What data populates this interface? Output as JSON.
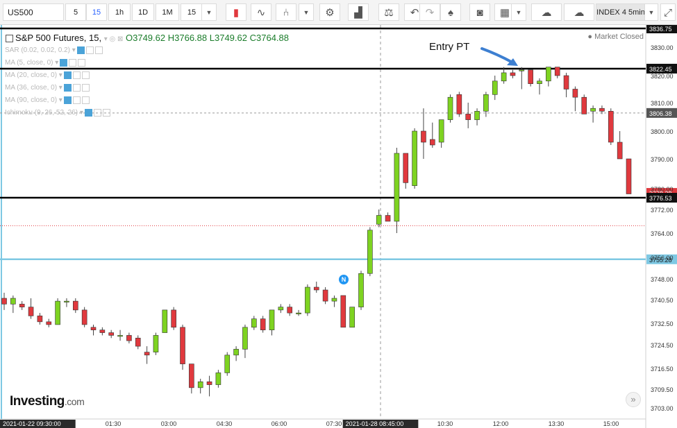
{
  "toolbar": {
    "symbol": "US500",
    "intervals": [
      "5",
      "15",
      "1h",
      "1D",
      "1M",
      "15"
    ],
    "active_interval": "15",
    "right_label": "INDEX 4 5min",
    "icons": [
      "dropdown-icon",
      "candles-icon",
      "indicators-icon",
      "fork-icon",
      "dropdown-icon",
      "settings-icon",
      "compare-icon",
      "balance-icon",
      "undo-icon",
      "redo-icon",
      "alert-icon",
      "camera-icon",
      "layout-icon",
      "dropdown-icon",
      "cloud-download-icon",
      "cloud-upload-icon",
      "dropdown-icon",
      "fullscreen-icon"
    ]
  },
  "legend": {
    "title": "S&P 500 Futures, 15,",
    "open": "O3749.62",
    "high": "H3766.88",
    "low": "L3749.62",
    "close": "C3764.88",
    "market_status": "Market Closed",
    "indicators": [
      "SAR (0.02, 0.02, 0.2)",
      "MA (5, close, 0)",
      "MA (20, close, 0)",
      "MA (36, close, 0)",
      "MA (90, close, 0)",
      "Ichimoku (9, 26, 52, 26)"
    ]
  },
  "annotation": {
    "entry_label": "Entry PT",
    "news_badge": "N"
  },
  "brand": {
    "logo": "Investing",
    "logo_suffix": ".com",
    "scroll_glyph": "»"
  },
  "colors": {
    "up": "#7ed321",
    "down": "#e0393e",
    "blue_line": "#7ec8e3",
    "red_dotted": "#e0393e"
  },
  "chart_data": {
    "type": "candlestick",
    "y_ticks": [
      3830,
      3820,
      3810,
      3800,
      3790,
      3780,
      3772,
      3764,
      3756,
      3748,
      3740.5,
      3732.5,
      3724.5,
      3716.5,
      3709.5,
      3703
    ],
    "x_ticks": [
      "2021-01-22 09:30:00",
      "01:30",
      "03:00",
      "04:30",
      "06:00",
      "07:30",
      "2021-01-28 08:45:00",
      "10:30",
      "12:00",
      "13:30",
      "15:00"
    ],
    "levels": [
      {
        "price": 3836.75,
        "label": "3836.75",
        "style": "black-thick"
      },
      {
        "price": 3822.45,
        "label": "3822.45",
        "style": "black-thick"
      },
      {
        "price": 3806.38,
        "label": "3806.38",
        "style": "grey-dashed"
      },
      {
        "price": 3778.38,
        "label": "3778.38",
        "style": "red-price"
      },
      {
        "price": 3776.53,
        "label": "3776.53",
        "style": "black-thick"
      },
      {
        "price": 3766.5,
        "label": "",
        "style": "red-dotted"
      },
      {
        "price": 3755.28,
        "label": "3755.28",
        "style": "blue-thick"
      }
    ],
    "candles": [
      [
        3741,
        3743,
        3737,
        3739
      ],
      [
        3739,
        3742,
        3736,
        3741
      ],
      [
        3739,
        3740,
        3737,
        3738
      ],
      [
        3738,
        3741,
        3734,
        3735
      ],
      [
        3735,
        3736,
        3732,
        3733
      ],
      [
        3733,
        3734,
        3731,
        3732
      ],
      [
        3732,
        3741,
        3732,
        3740
      ],
      [
        3740,
        3741,
        3738,
        3740
      ],
      [
        3740,
        3741,
        3736,
        3737
      ],
      [
        3737,
        3738,
        3731,
        3732
      ],
      [
        3731,
        3732,
        3728,
        3730
      ],
      [
        3730,
        3731,
        3728,
        3729
      ],
      [
        3729,
        3730,
        3727,
        3728
      ],
      [
        3728,
        3730,
        3726,
        3728
      ],
      [
        3728,
        3729,
        3725,
        3726
      ],
      [
        3727,
        3728,
        3723,
        3724
      ],
      [
        3722,
        3724,
        3718,
        3721
      ],
      [
        3722,
        3729,
        3721,
        3728
      ],
      [
        3729,
        3737,
        3729,
        3737
      ],
      [
        3737,
        3738,
        3730,
        3731
      ],
      [
        3731,
        3732,
        3716,
        3718
      ],
      [
        3718,
        3718,
        3708,
        3710
      ],
      [
        3710,
        3713,
        3708,
        3712
      ],
      [
        3712,
        3714,
        3707,
        3711
      ],
      [
        3711,
        3716,
        3710,
        3715
      ],
      [
        3715,
        3722,
        3714,
        3721
      ],
      [
        3721,
        3724,
        3719,
        3723
      ],
      [
        3723,
        3732,
        3720,
        3731
      ],
      [
        3731,
        3735,
        3730,
        3734
      ],
      [
        3734,
        3735,
        3729,
        3730
      ],
      [
        3730,
        3737,
        3728,
        3737
      ],
      [
        3737,
        3739,
        3736,
        3738
      ],
      [
        3738,
        3739,
        3735,
        3736
      ],
      [
        3736,
        3737,
        3735,
        3736
      ],
      [
        3736,
        3746,
        3735,
        3745
      ],
      [
        3745,
        3747,
        3743,
        3744
      ],
      [
        3744,
        3745,
        3739,
        3740
      ],
      [
        3740,
        3742,
        3738,
        3741
      ],
      [
        3742,
        3742,
        3731,
        3731
      ],
      [
        3731,
        3738,
        3731,
        3738
      ],
      [
        3738,
        3751,
        3737,
        3750
      ],
      [
        3750,
        3766,
        3749,
        3765
      ],
      [
        3767,
        3772,
        3766,
        3770
      ],
      [
        3770,
        3771,
        3768,
        3768
      ],
      [
        3768,
        3794,
        3764,
        3792
      ],
      [
        3792,
        3792,
        3780,
        3782
      ],
      [
        3781,
        3801,
        3780,
        3800
      ],
      [
        3800,
        3808,
        3790,
        3796
      ],
      [
        3797,
        3803,
        3794,
        3795
      ],
      [
        3796,
        3804,
        3794,
        3804
      ],
      [
        3804,
        3813,
        3803,
        3812
      ],
      [
        3813,
        3814,
        3805,
        3806
      ],
      [
        3806,
        3810,
        3801,
        3804
      ],
      [
        3804,
        3808,
        3802,
        3807
      ],
      [
        3807,
        3814,
        3805,
        3813
      ],
      [
        3813,
        3820,
        3811,
        3818
      ],
      [
        3818,
        3823,
        3817,
        3821
      ],
      [
        3821,
        3822,
        3819,
        3820
      ],
      [
        3822,
        3823,
        3815,
        3822
      ],
      [
        3822,
        3822,
        3816,
        3817
      ],
      [
        3817,
        3819,
        3813,
        3818
      ],
      [
        3818,
        3823,
        3816,
        3823
      ],
      [
        3823,
        3823,
        3819,
        3820
      ],
      [
        3820,
        3821,
        3812,
        3815
      ],
      [
        3815,
        3816,
        3807,
        3812
      ],
      [
        3812,
        3813,
        3806,
        3806
      ],
      [
        3807,
        3809,
        3803,
        3808
      ],
      [
        3808,
        3809,
        3806,
        3807
      ],
      [
        3807,
        3808,
        3795,
        3796
      ],
      [
        3796,
        3800,
        3790,
        3790
      ],
      [
        3790,
        3790,
        3778,
        3778
      ]
    ]
  }
}
